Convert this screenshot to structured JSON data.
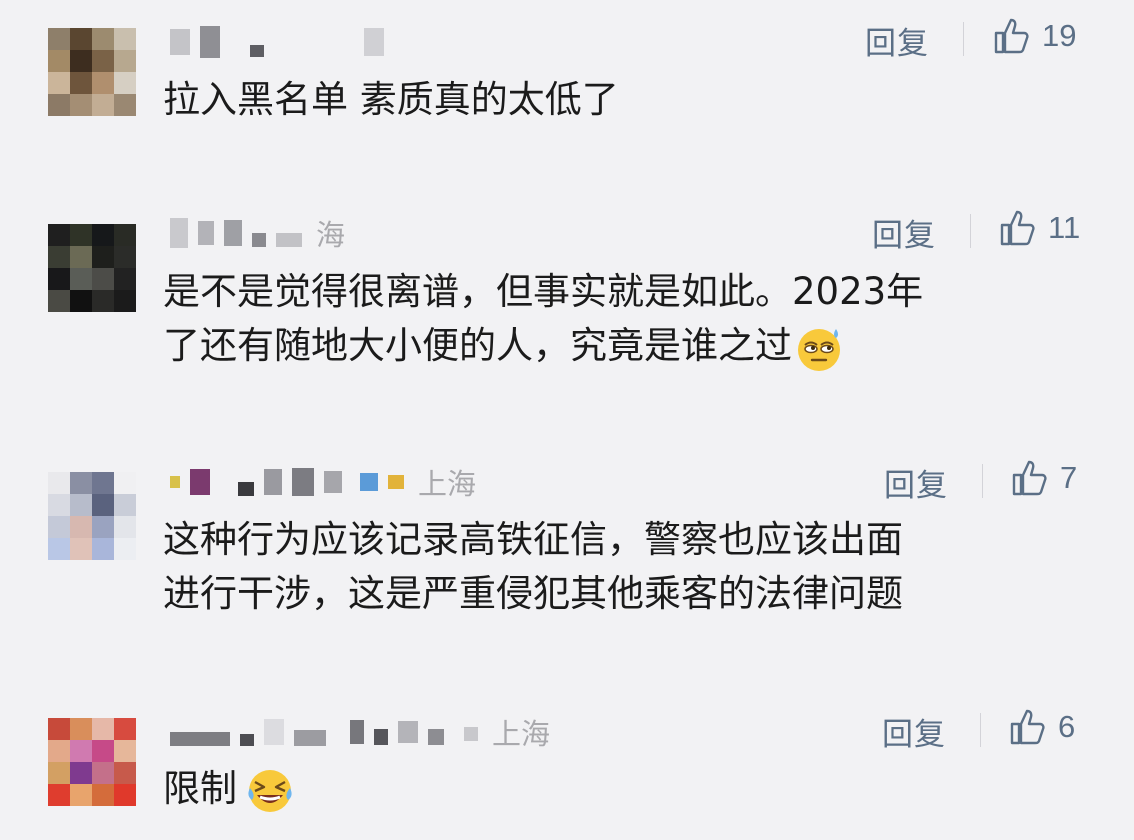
{
  "comments": [
    {
      "username": "",
      "location": "",
      "reply_label": "回复",
      "like_count": "19",
      "lines": [
        "拉入黑名单 素质真的太低了"
      ],
      "emoji": ""
    },
    {
      "username": "",
      "location": "海",
      "reply_label": "回复",
      "like_count": "11",
      "lines": [
        "是不是觉得很离谱，但事实就是如此。2023年",
        "了还有随地大小便的人，究竟是谁之过"
      ],
      "emoji": "sweat-eyeroll-emoji"
    },
    {
      "username": "",
      "location": "上海",
      "reply_label": "回复",
      "like_count": "7",
      "lines": [
        "这种行为应该记录高铁征信，警察也应该出面",
        "进行干涉，这是严重侵犯其他乘客的法律问题"
      ],
      "emoji": ""
    },
    {
      "username": "",
      "location": "上海",
      "reply_label": "回复",
      "like_count": "6",
      "lines": [
        "限制"
      ],
      "emoji": "laughing-tears-emoji"
    }
  ],
  "colors": {
    "background": "#f2f2f4",
    "text": "#1b1b1b",
    "meta": "#5b6f86",
    "location": "#a9a9ad"
  },
  "icons": {
    "like": "thumbs-up-icon"
  }
}
